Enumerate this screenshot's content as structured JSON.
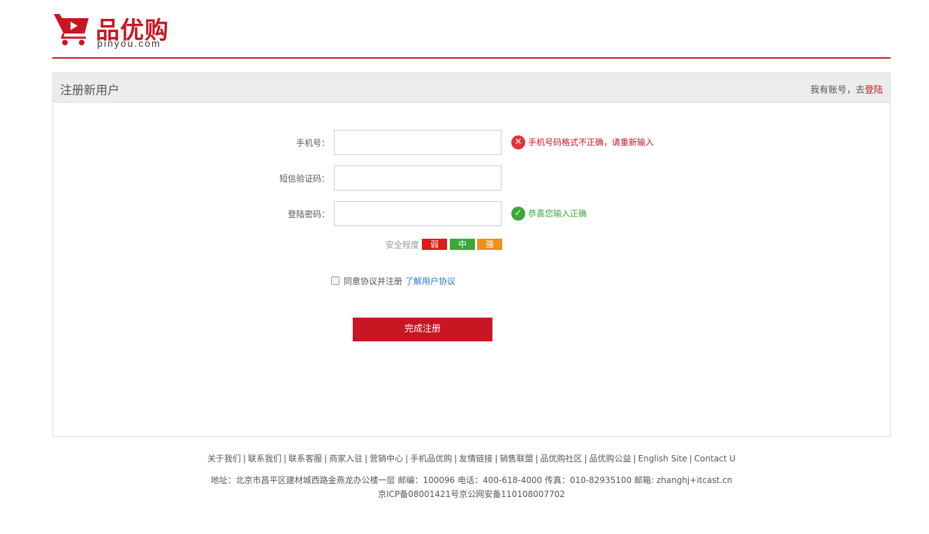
{
  "header": {
    "logo_cn": "品优购",
    "logo_en": "pinyou.com",
    "brand_color": "#c81623"
  },
  "panel": {
    "title": "注册新用户",
    "login_prefix": "我有账号，去",
    "login_link": "登陆"
  },
  "form": {
    "phone": {
      "label": "手机号：",
      "value": "",
      "message": "手机号码格式不正确，请重新输入",
      "status": "error"
    },
    "sms": {
      "label": "短信验证码：",
      "value": ""
    },
    "password": {
      "label": "登陆密码：",
      "value": "",
      "message": "恭喜您输入正确",
      "status": "success"
    },
    "strength": {
      "label": "安全程度",
      "weak": "弱",
      "medium": "中",
      "strong": "强"
    },
    "agree": {
      "checked": false,
      "text": "同意协议并注册",
      "link": "了解用户协议"
    },
    "submit": "完成注册"
  },
  "footer": {
    "links": [
      "关于我们",
      "联系我们",
      "联系客服",
      "商家入驻",
      "营销中心",
      "手机品优购",
      "友情链接",
      "销售联盟",
      "品优购社区",
      "品优购公益",
      "English Site",
      "Contact U"
    ],
    "address": "地址：北京市昌平区建材城西路金燕龙办公楼一层 邮编：100096 电话：400-618-4000 传真：010-82935100 邮箱: zhanghj+itcast.cn",
    "icp": "京ICP备08001421号京公网安备110108007702"
  },
  "icons": {
    "error": "error-circle-icon",
    "success": "check-circle-icon",
    "logo": "shopping-cart-play-icon"
  }
}
